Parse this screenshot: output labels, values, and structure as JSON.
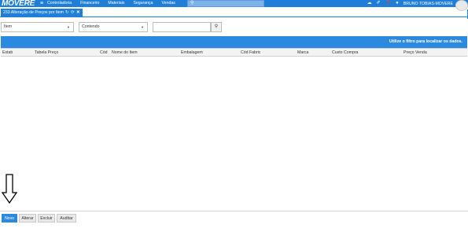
{
  "app": {
    "logo_text": "MOVERE",
    "menu": [
      "Controladoria",
      "Financeiro",
      "Materiais",
      "Segurança",
      "Vendas"
    ],
    "user": "BRUNO TOBIAS-MOVERE"
  },
  "tab": {
    "title": "233 Alteração de Preços por Item",
    "controls": [
      "↻",
      "⟳",
      "✕"
    ]
  },
  "filters": {
    "field": "Item",
    "operator": "Contendo",
    "value": ""
  },
  "grid": {
    "hint": "Utilize o filtro para localizar os dados.",
    "columns": [
      "Estab",
      "Tabela Preço",
      "Cód",
      "Nome do Item",
      "Embalagem",
      "Cód Fabric",
      "Marca",
      "Custo Compra",
      "Preço Venda"
    ],
    "rows": []
  },
  "footer": {
    "buttons": [
      "Novo",
      "Alterar",
      "Excluir",
      "Auditar"
    ]
  },
  "colors": {
    "accent": "#1f7fd8",
    "grid_bar": "#2b8ae0"
  },
  "icons": [
    "menu-icon",
    "search-icon",
    "cloud-icon",
    "wrench-icon",
    "help-icon",
    "bell-icon",
    "refresh-icon",
    "close-icon",
    "down-arrow-icon"
  ]
}
